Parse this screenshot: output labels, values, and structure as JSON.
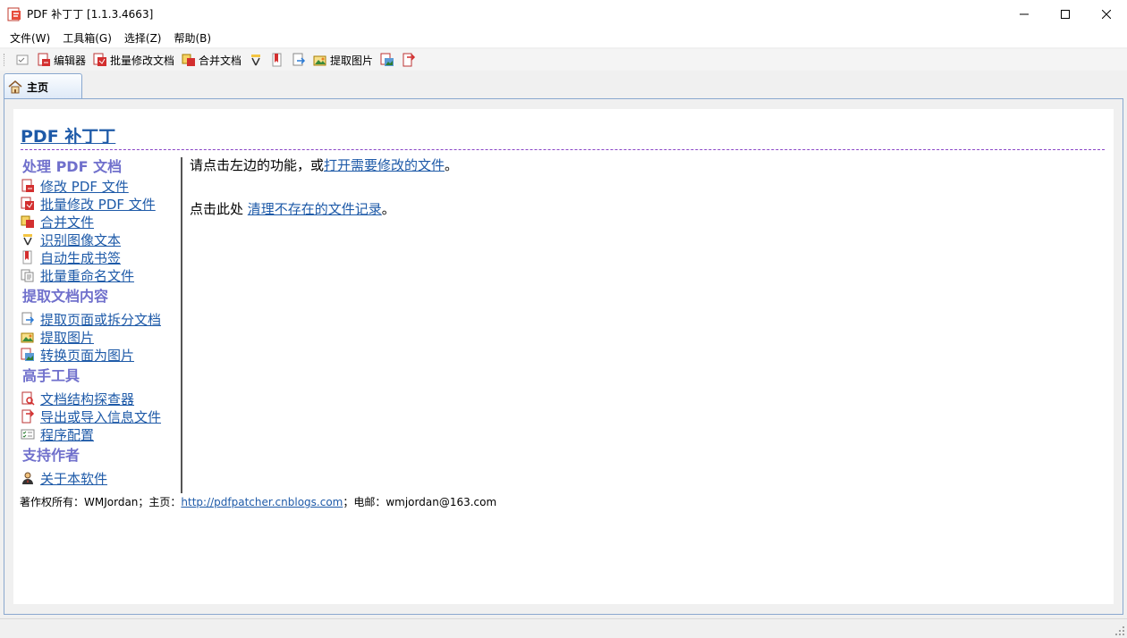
{
  "window": {
    "title": "PDF 补丁丁 [1.1.3.4663]",
    "icon": "pdf-patcher-icon"
  },
  "menu": {
    "items": [
      "文件(W)",
      "工具箱(G)",
      "选择(Z)",
      "帮助(B)"
    ]
  },
  "toolbar": {
    "editor": "编辑器",
    "batch_modify": "批量修改文档",
    "merge": "合并文档",
    "extract_images": "提取图片"
  },
  "tabs": {
    "home": "主页"
  },
  "home": {
    "title": "PDF 补丁丁",
    "sections": [
      {
        "title": "处理 PDF 文档",
        "links": [
          {
            "label": "修改 PDF 文件",
            "icon": "pdf-edit-icon"
          },
          {
            "label": "批量修改 PDF 文件",
            "icon": "pdf-batch-icon"
          },
          {
            "label": "合并文件",
            "icon": "merge-icon"
          },
          {
            "label": "识别图像文本",
            "icon": "ocr-icon"
          },
          {
            "label": "自动生成书签",
            "icon": "bookmark-icon"
          },
          {
            "label": "批量重命名文件",
            "icon": "rename-icon"
          }
        ]
      },
      {
        "title": "提取文档内容",
        "links": [
          {
            "label": "提取页面或拆分文档",
            "icon": "extract-pages-icon"
          },
          {
            "label": "提取图片",
            "icon": "extract-images-icon"
          },
          {
            "label": "转换页面为图片",
            "icon": "render-pages-icon"
          }
        ]
      },
      {
        "title": "高手工具",
        "links": [
          {
            "label": "文档结构探查器",
            "icon": "inspector-icon"
          },
          {
            "label": "导出或导入信息文件",
            "icon": "export-import-icon"
          },
          {
            "label": "程序配置",
            "icon": "config-icon"
          }
        ]
      },
      {
        "title": "支持作者",
        "links": [
          {
            "label": "关于本软件",
            "icon": "about-person-icon"
          }
        ]
      }
    ],
    "prompt_prefix": "请点击左边的功能，或",
    "prompt_link": "打开需要修改的文件",
    "prompt_suffix": "。",
    "clean_prefix": "点击此处 ",
    "clean_link": "清理不存在的文件记录",
    "clean_suffix": "。",
    "footer_prefix": "著作权所有：WMJordan；主页：",
    "footer_link": "http://pdfpatcher.cnblogs.com",
    "footer_suffix": "；电邮：wmjordan@163.com"
  }
}
